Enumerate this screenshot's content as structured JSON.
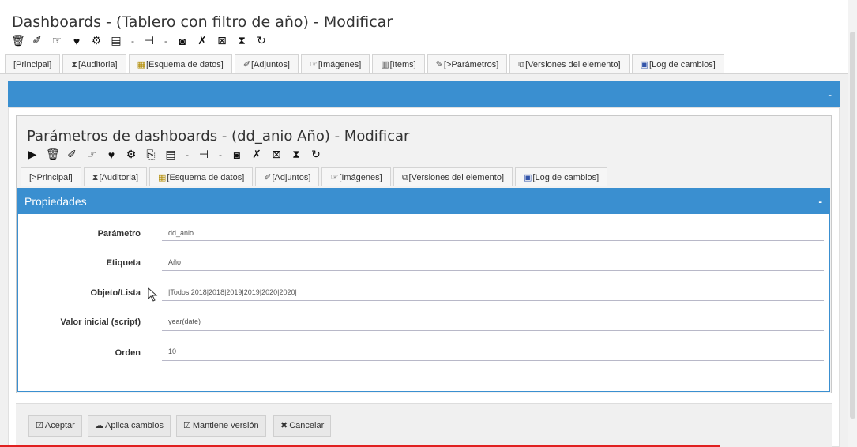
{
  "outer": {
    "title": "Dashboards - (Tablero con filtro de año) - Modificar",
    "toolbar_icons": [
      "trash-icon",
      "pin-icon",
      "hand-icon",
      "heart-icon",
      "tools-icon",
      "clipboard-icon",
      "dropdown",
      "transfer-icon",
      "dropdown",
      "binoculars-icon",
      "wrench-icon",
      "box-icon",
      "hourglass-icon",
      "refresh-icon"
    ],
    "tabs": [
      {
        "icon": "",
        "label": "[Principal]"
      },
      {
        "icon": "hourglass-icon",
        "label": "[Auditoria]"
      },
      {
        "icon": "schema-icon",
        "label": "[Esquema de datos]"
      },
      {
        "icon": "pin-icon",
        "label": "[Adjuntos]"
      },
      {
        "icon": "hand-icon",
        "label": "[Imágenes]"
      },
      {
        "icon": "bar-chart-icon",
        "label": "[Items]"
      },
      {
        "icon": "edit-icon",
        "label": "[>Parámetros]"
      },
      {
        "icon": "versions-icon",
        "label": "[Versiones del elemento]"
      },
      {
        "icon": "log-icon",
        "label": "[Log de cambios]"
      }
    ],
    "collapse": "-"
  },
  "inner": {
    "title": "Parámetros de dashboards - (dd_anio Año) - Modificar",
    "tabs": [
      {
        "icon": "",
        "label": "[>Principal]"
      },
      {
        "icon": "hourglass-icon",
        "label": "[Auditoria]"
      },
      {
        "icon": "schema-icon",
        "label": "[Esquema de datos]"
      },
      {
        "icon": "pin-icon",
        "label": "[Adjuntos]"
      },
      {
        "icon": "hand-icon",
        "label": "[Imágenes]"
      },
      {
        "icon": "versions-icon",
        "label": "[Versiones del elemento]"
      },
      {
        "icon": "log-icon",
        "label": "[Log de cambios]"
      }
    ]
  },
  "props": {
    "header": "Propiedades",
    "collapse": "-",
    "fields": [
      {
        "label": "Parámetro",
        "value": "dd_anio"
      },
      {
        "label": "Etiqueta",
        "value": "Año"
      },
      {
        "label": "Objeto/Lista",
        "value": "|Todos|2018|2018|2019|2019|2020|2020|"
      },
      {
        "label": "Valor inicial (script)",
        "value": "year(date)"
      },
      {
        "label": "Orden",
        "value": "10"
      }
    ]
  },
  "buttons": {
    "accept": "Aceptar",
    "apply": "Aplica cambios",
    "keep_version": "Mantiene versión",
    "cancel": "Cancelar"
  }
}
